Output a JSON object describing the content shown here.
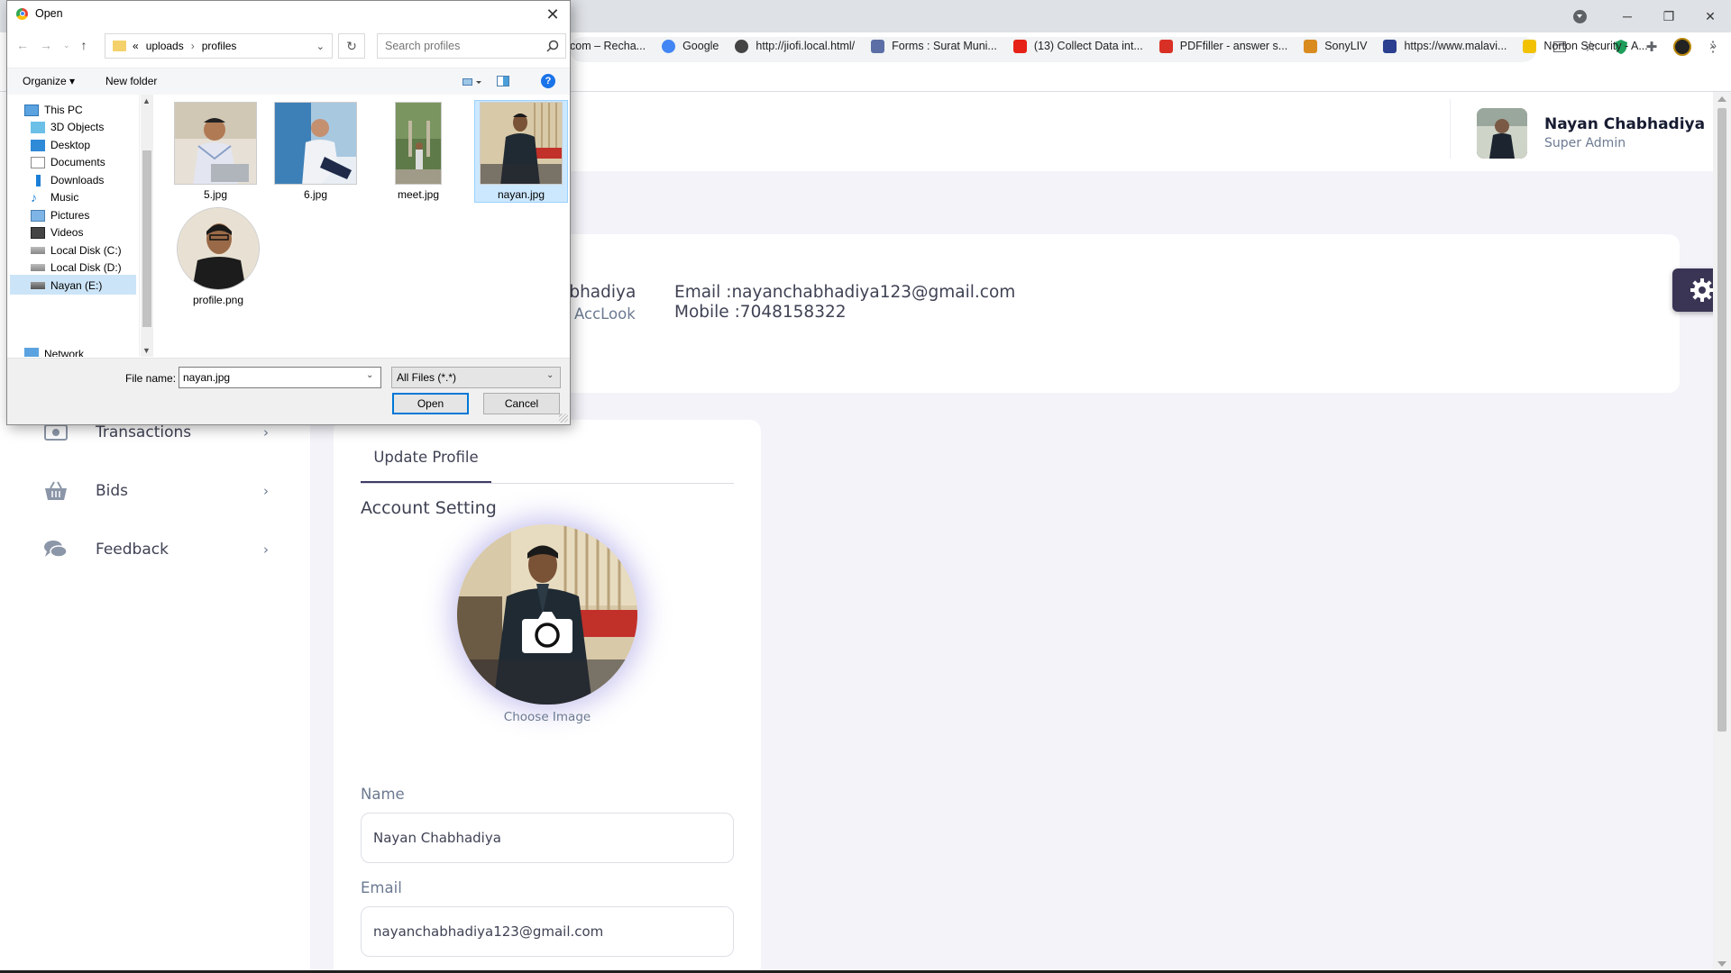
{
  "browser": {
    "bookmarks": [
      {
        "label": "com – Recha...",
        "icon": "bookmark-favicon"
      },
      {
        "label": "Google",
        "icon": "google-icon"
      },
      {
        "label": "http://jiofi.local.html/",
        "icon": "globe-icon"
      },
      {
        "label": "Forms : Surat Muni...",
        "icon": "forms-icon"
      },
      {
        "label": "(13) Collect Data int...",
        "icon": "youtube-icon"
      },
      {
        "label": "PDFfiller - answer s...",
        "icon": "pdffiller-icon"
      },
      {
        "label": "SonyLIV",
        "icon": "sonyliv-icon"
      },
      {
        "label": "https://www.malavi...",
        "icon": "malavi-icon"
      },
      {
        "label": "Norton Security - A...",
        "icon": "norton-icon"
      }
    ],
    "overflow": "»"
  },
  "sidebar": {
    "items": [
      {
        "label": "Transactions",
        "icon": "money-icon"
      },
      {
        "label": "Bids",
        "icon": "basket-icon"
      },
      {
        "label": "Feedback",
        "icon": "comments-icon"
      }
    ]
  },
  "header": {
    "user_name": "Nayan Chabhadiya",
    "user_role": "Super Admin"
  },
  "profile_card": {
    "name_partial": "abhadiya",
    "company_partial": "AccLook",
    "email": "Email :nayanchabhadiya123@gmail.com",
    "mobile": "Mobile :7048158322"
  },
  "update_profile": {
    "tab": "Update Profile",
    "section_title": "Account Setting",
    "choose_image": "Choose Image",
    "name_label": "Name",
    "name_value": "Nayan Chabhadiya",
    "email_label": "Email",
    "email_value": "nayanchabhadiya123@gmail.com"
  },
  "dialog": {
    "title": "Open",
    "path_prefix": "«",
    "path": [
      "uploads",
      "profiles"
    ],
    "search_placeholder": "Search profiles",
    "organize": "Organize ▾",
    "new_folder": "New folder",
    "help": "?",
    "tree": [
      {
        "label": "This PC",
        "icon": "pc-icon"
      },
      {
        "label": "3D Objects",
        "icon": "3d-objects-icon"
      },
      {
        "label": "Desktop",
        "icon": "desktop-icon"
      },
      {
        "label": "Documents",
        "icon": "documents-icon"
      },
      {
        "label": "Downloads",
        "icon": "downloads-icon"
      },
      {
        "label": "Music",
        "icon": "music-icon"
      },
      {
        "label": "Pictures",
        "icon": "pictures-icon"
      },
      {
        "label": "Videos",
        "icon": "videos-icon"
      },
      {
        "label": "Local Disk (C:)",
        "icon": "drive-icon",
        "selected": true
      },
      {
        "label": "Local Disk (D:)",
        "icon": "drive-icon"
      },
      {
        "label": "Nayan (E:)",
        "icon": "drive-icon"
      },
      {
        "label": "Network",
        "icon": "network-icon"
      }
    ],
    "files": [
      {
        "name": "5.jpg"
      },
      {
        "name": "6.jpg"
      },
      {
        "name": "meet.jpg"
      },
      {
        "name": "nayan.jpg",
        "selected": true
      },
      {
        "name": "profile.png"
      }
    ],
    "file_name_label": "File name:",
    "file_name_value": "nayan.jpg",
    "file_type": "All Files (*.*)",
    "open_label": "Open",
    "cancel_label": "Cancel"
  }
}
